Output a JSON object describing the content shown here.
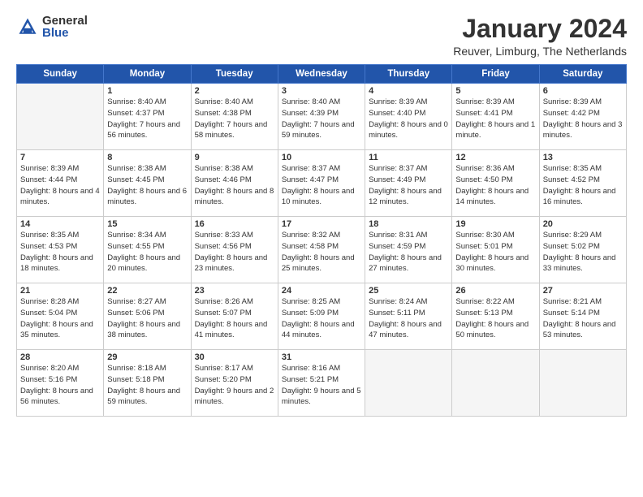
{
  "logo": {
    "general": "General",
    "blue": "Blue"
  },
  "title": "January 2024",
  "location": "Reuver, Limburg, The Netherlands",
  "headers": [
    "Sunday",
    "Monday",
    "Tuesday",
    "Wednesday",
    "Thursday",
    "Friday",
    "Saturday"
  ],
  "weeks": [
    [
      {
        "day": "",
        "sunrise": "",
        "sunset": "",
        "daylight": ""
      },
      {
        "day": "1",
        "sunrise": "Sunrise: 8:40 AM",
        "sunset": "Sunset: 4:37 PM",
        "daylight": "Daylight: 7 hours and 56 minutes."
      },
      {
        "day": "2",
        "sunrise": "Sunrise: 8:40 AM",
        "sunset": "Sunset: 4:38 PM",
        "daylight": "Daylight: 7 hours and 58 minutes."
      },
      {
        "day": "3",
        "sunrise": "Sunrise: 8:40 AM",
        "sunset": "Sunset: 4:39 PM",
        "daylight": "Daylight: 7 hours and 59 minutes."
      },
      {
        "day": "4",
        "sunrise": "Sunrise: 8:39 AM",
        "sunset": "Sunset: 4:40 PM",
        "daylight": "Daylight: 8 hours and 0 minutes."
      },
      {
        "day": "5",
        "sunrise": "Sunrise: 8:39 AM",
        "sunset": "Sunset: 4:41 PM",
        "daylight": "Daylight: 8 hours and 1 minute."
      },
      {
        "day": "6",
        "sunrise": "Sunrise: 8:39 AM",
        "sunset": "Sunset: 4:42 PM",
        "daylight": "Daylight: 8 hours and 3 minutes."
      }
    ],
    [
      {
        "day": "7",
        "sunrise": "Sunrise: 8:39 AM",
        "sunset": "Sunset: 4:44 PM",
        "daylight": "Daylight: 8 hours and 4 minutes."
      },
      {
        "day": "8",
        "sunrise": "Sunrise: 8:38 AM",
        "sunset": "Sunset: 4:45 PM",
        "daylight": "Daylight: 8 hours and 6 minutes."
      },
      {
        "day": "9",
        "sunrise": "Sunrise: 8:38 AM",
        "sunset": "Sunset: 4:46 PM",
        "daylight": "Daylight: 8 hours and 8 minutes."
      },
      {
        "day": "10",
        "sunrise": "Sunrise: 8:37 AM",
        "sunset": "Sunset: 4:47 PM",
        "daylight": "Daylight: 8 hours and 10 minutes."
      },
      {
        "day": "11",
        "sunrise": "Sunrise: 8:37 AM",
        "sunset": "Sunset: 4:49 PM",
        "daylight": "Daylight: 8 hours and 12 minutes."
      },
      {
        "day": "12",
        "sunrise": "Sunrise: 8:36 AM",
        "sunset": "Sunset: 4:50 PM",
        "daylight": "Daylight: 8 hours and 14 minutes."
      },
      {
        "day": "13",
        "sunrise": "Sunrise: 8:35 AM",
        "sunset": "Sunset: 4:52 PM",
        "daylight": "Daylight: 8 hours and 16 minutes."
      }
    ],
    [
      {
        "day": "14",
        "sunrise": "Sunrise: 8:35 AM",
        "sunset": "Sunset: 4:53 PM",
        "daylight": "Daylight: 8 hours and 18 minutes."
      },
      {
        "day": "15",
        "sunrise": "Sunrise: 8:34 AM",
        "sunset": "Sunset: 4:55 PM",
        "daylight": "Daylight: 8 hours and 20 minutes."
      },
      {
        "day": "16",
        "sunrise": "Sunrise: 8:33 AM",
        "sunset": "Sunset: 4:56 PM",
        "daylight": "Daylight: 8 hours and 23 minutes."
      },
      {
        "day": "17",
        "sunrise": "Sunrise: 8:32 AM",
        "sunset": "Sunset: 4:58 PM",
        "daylight": "Daylight: 8 hours and 25 minutes."
      },
      {
        "day": "18",
        "sunrise": "Sunrise: 8:31 AM",
        "sunset": "Sunset: 4:59 PM",
        "daylight": "Daylight: 8 hours and 27 minutes."
      },
      {
        "day": "19",
        "sunrise": "Sunrise: 8:30 AM",
        "sunset": "Sunset: 5:01 PM",
        "daylight": "Daylight: 8 hours and 30 minutes."
      },
      {
        "day": "20",
        "sunrise": "Sunrise: 8:29 AM",
        "sunset": "Sunset: 5:02 PM",
        "daylight": "Daylight: 8 hours and 33 minutes."
      }
    ],
    [
      {
        "day": "21",
        "sunrise": "Sunrise: 8:28 AM",
        "sunset": "Sunset: 5:04 PM",
        "daylight": "Daylight: 8 hours and 35 minutes."
      },
      {
        "day": "22",
        "sunrise": "Sunrise: 8:27 AM",
        "sunset": "Sunset: 5:06 PM",
        "daylight": "Daylight: 8 hours and 38 minutes."
      },
      {
        "day": "23",
        "sunrise": "Sunrise: 8:26 AM",
        "sunset": "Sunset: 5:07 PM",
        "daylight": "Daylight: 8 hours and 41 minutes."
      },
      {
        "day": "24",
        "sunrise": "Sunrise: 8:25 AM",
        "sunset": "Sunset: 5:09 PM",
        "daylight": "Daylight: 8 hours and 44 minutes."
      },
      {
        "day": "25",
        "sunrise": "Sunrise: 8:24 AM",
        "sunset": "Sunset: 5:11 PM",
        "daylight": "Daylight: 8 hours and 47 minutes."
      },
      {
        "day": "26",
        "sunrise": "Sunrise: 8:22 AM",
        "sunset": "Sunset: 5:13 PM",
        "daylight": "Daylight: 8 hours and 50 minutes."
      },
      {
        "day": "27",
        "sunrise": "Sunrise: 8:21 AM",
        "sunset": "Sunset: 5:14 PM",
        "daylight": "Daylight: 8 hours and 53 minutes."
      }
    ],
    [
      {
        "day": "28",
        "sunrise": "Sunrise: 8:20 AM",
        "sunset": "Sunset: 5:16 PM",
        "daylight": "Daylight: 8 hours and 56 minutes."
      },
      {
        "day": "29",
        "sunrise": "Sunrise: 8:18 AM",
        "sunset": "Sunset: 5:18 PM",
        "daylight": "Daylight: 8 hours and 59 minutes."
      },
      {
        "day": "30",
        "sunrise": "Sunrise: 8:17 AM",
        "sunset": "Sunset: 5:20 PM",
        "daylight": "Daylight: 9 hours and 2 minutes."
      },
      {
        "day": "31",
        "sunrise": "Sunrise: 8:16 AM",
        "sunset": "Sunset: 5:21 PM",
        "daylight": "Daylight: 9 hours and 5 minutes."
      },
      {
        "day": "",
        "sunrise": "",
        "sunset": "",
        "daylight": ""
      },
      {
        "day": "",
        "sunrise": "",
        "sunset": "",
        "daylight": ""
      },
      {
        "day": "",
        "sunrise": "",
        "sunset": "",
        "daylight": ""
      }
    ]
  ]
}
